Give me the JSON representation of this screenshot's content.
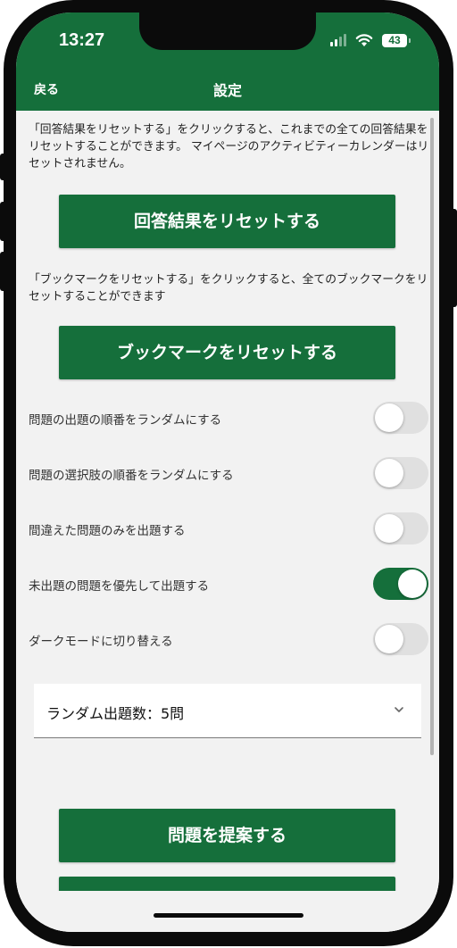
{
  "status_bar": {
    "time": "13:27",
    "battery": "43"
  },
  "nav": {
    "back_label": "戻る",
    "title": "設定"
  },
  "reset_answers": {
    "description": "「回答結果をリセットする」をクリックすると、これまでの全ての回答結果をリセットすることができます。 マイページのアクティビティーカレンダーはリセットされません。",
    "button_label": "回答結果をリセットする"
  },
  "reset_bookmarks": {
    "description": "「ブックマークをリセットする」をクリックすると、全てのブックマークをリセットすることができます",
    "button_label": "ブックマークをリセットする"
  },
  "toggles": [
    {
      "label": "問題の出題の順番をランダムにする",
      "on": false
    },
    {
      "label": "問題の選択肢の順番をランダムにする",
      "on": false
    },
    {
      "label": "間違えた問題のみを出題する",
      "on": false
    },
    {
      "label": "未出題の問題を優先して出題する",
      "on": true
    },
    {
      "label": "ダークモードに切り替える",
      "on": false
    }
  ],
  "random_count_select": {
    "value": "ランダム出題数：5問"
  },
  "suggest_button": {
    "label": "問題を提案する"
  },
  "colors": {
    "brand_green": "#156f3b",
    "background": "#f2f2f2"
  }
}
